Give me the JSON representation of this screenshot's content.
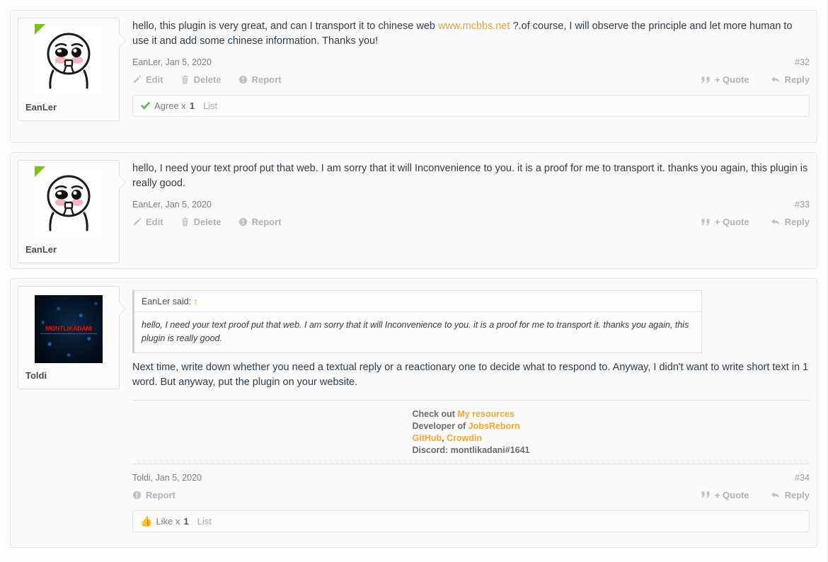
{
  "page": {
    "background": "#fdfdfd",
    "link_color": "#e8a33d",
    "muted_color": "#b2b2b2"
  },
  "posts": [
    {
      "id": "post-32",
      "author": "EanLer",
      "avatar_type": "cartoon-face",
      "online_badge": true,
      "body_before_link": "hello, this plugin is very great, and can I transport it to chinese web ",
      "body_link": "www.mcbbs.net",
      "body_after_link": " ?.of course, I will observe the principle and let more human to use it and add some chinese information. Thanks you!",
      "meta": "EanLer, Jan 5, 2020",
      "post_number": "#32",
      "actions_left": [
        {
          "name": "edit",
          "label": "Edit",
          "icon": "pencil-icon"
        },
        {
          "name": "delete",
          "label": "Delete",
          "icon": "trash-icon"
        },
        {
          "name": "report",
          "label": "Report",
          "icon": "exclamation-circle-icon"
        }
      ],
      "actions_right": [
        {
          "name": "quote",
          "label": "+ Quote",
          "icon": "quote-marks-icon"
        },
        {
          "name": "reply",
          "label": "Reply",
          "icon": "reply-arrow-icon"
        }
      ],
      "rating": {
        "icon": "green-check-icon",
        "label": "Agree x",
        "count": "1",
        "list_label": "List"
      }
    },
    {
      "id": "post-33",
      "author": "EanLer",
      "avatar_type": "cartoon-face",
      "online_badge": true,
      "body": "hello, I need your text proof put that web. I am sorry that it will Inconvenience to you. it is a proof for me to transport it. thanks you again, this plugin is really good.",
      "meta": "EanLer, Jan 5, 2020",
      "post_number": "#33",
      "actions_left": [
        {
          "name": "edit",
          "label": "Edit",
          "icon": "pencil-icon"
        },
        {
          "name": "delete",
          "label": "Delete",
          "icon": "trash-icon"
        },
        {
          "name": "report",
          "label": "Report",
          "icon": "exclamation-circle-icon"
        }
      ],
      "actions_right": [
        {
          "name": "quote",
          "label": "+ Quote",
          "icon": "quote-marks-icon"
        },
        {
          "name": "reply",
          "label": "Reply",
          "icon": "reply-arrow-icon"
        }
      ]
    },
    {
      "id": "post-34",
      "author": "Toldi",
      "avatar_type": "dark-montlikadani",
      "avatar_nick": "MONTLIKADANI",
      "online_badge": false,
      "quote": {
        "header": "EanLer said:",
        "arrow": "↑",
        "text": "hello, I need your text proof put that web. I am sorry that it will Inconvenience to you. it is a proof for me to transport it. thanks you again, this plugin is really good."
      },
      "body": "Next time, write down whether you need a textual reply or a reactionary one to decide what to respond to. Anyway, I didn't want to write short text in 1 word. But anyway, put the plugin on your website.",
      "signature": {
        "line1_prefix": "Check out ",
        "line1_link": "My resources",
        "line2_prefix": "Developer of ",
        "line2_link": "JobsReborn",
        "line3_link_a": "GitHub",
        "line3_sep": ", ",
        "line3_link_b": "Crowdin",
        "line4": "Discord: montlikadani#1641"
      },
      "meta": "Toldi, Jan 5, 2020",
      "post_number": "#34",
      "actions_left": [
        {
          "name": "report",
          "label": "Report",
          "icon": "exclamation-circle-icon"
        }
      ],
      "actions_right": [
        {
          "name": "quote",
          "label": "+ Quote",
          "icon": "quote-marks-icon"
        },
        {
          "name": "reply",
          "label": "Reply",
          "icon": "reply-arrow-icon"
        }
      ],
      "rating": {
        "icon": "thumbs-up-icon",
        "label": "Like x",
        "count": "1",
        "list_label": "List"
      }
    }
  ]
}
